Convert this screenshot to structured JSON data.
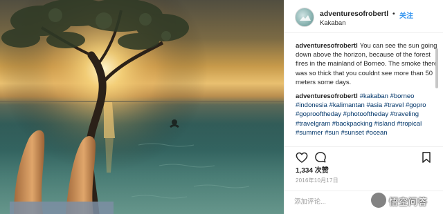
{
  "header": {
    "username": "adventuresofrobertl",
    "separator": "•",
    "follow_label": "关注",
    "location": "Kakaban"
  },
  "comments": [
    {
      "username": "adventuresofrobertl",
      "text": "You can see the sun going down above the horizon, because of the forest fires in the mainland of Borneo. The smoke there was so thick that you couldnt see more than 50 meters some days."
    },
    {
      "username": "adventuresofrobertl",
      "text": "#kakaban #borneo #indonesia #kalimantan #asia #travel #gopro #goprooftheday #photooftheday #traveling #travelgram #backpacking #island #tropical #summer #sun #sunset #ocean"
    }
  ],
  "icons": {
    "like": "heart-outline-icon",
    "comment": "speech-bubble-icon",
    "save": "bookmark-icon"
  },
  "likes": "1,334 次赞",
  "date": "2016年10月17日",
  "add_comment": {
    "placeholder": "添加评论..."
  },
  "watermark": {
    "text": "悟空问答"
  },
  "colors": {
    "link": "#3897f0",
    "hashtag": "#003569",
    "meta": "#999999",
    "text": "#262626"
  }
}
